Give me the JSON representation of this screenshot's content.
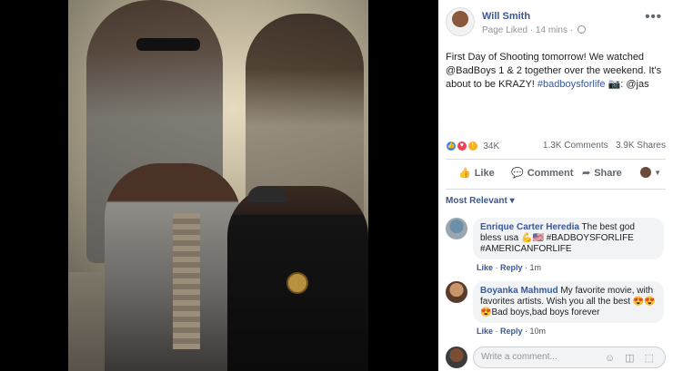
{
  "post": {
    "author": "Will Smith",
    "meta": "Page Liked · 14 mins ·",
    "text_plain_1": "First Day of Shooting tomorrow! We watched @BadBoys 1 & 2 together over the weekend. It's about to be KRAZY! ",
    "hashtag": "#badboysforlife",
    "text_plain_2": " 📷: @jas",
    "more": "•••"
  },
  "stats": {
    "reactions": "34K",
    "comments": "1.3K Comments",
    "shares": "3.9K Shares"
  },
  "actions": {
    "like": "Like",
    "comment": "Comment",
    "share": "Share"
  },
  "sort_label": "Most Relevant ▾",
  "comments": [
    {
      "name": "Enrique Carter Heredia",
      "text": " The best god bless usa 💪🇺🇸 #BADBOYSFORLIFE #AMERICANFORLIFE",
      "like": "Like",
      "reply": "Reply",
      "time": "1m"
    },
    {
      "name": "Boyanka Mahmud",
      "text": " My favorite movie, with favorites artists. Wish you all the best 😍😍😍Bad boys,bad boys forever",
      "like": "Like",
      "reply": "Reply",
      "time": "10m"
    }
  ],
  "composer": {
    "placeholder": "Write a comment...",
    "icons": "☺ ◫ ⬚"
  },
  "colors": {
    "link": "#385898",
    "bubble": "#f2f3f5",
    "like": "#2d88ff",
    "love": "#f33e58",
    "wow": "#f7b125"
  }
}
